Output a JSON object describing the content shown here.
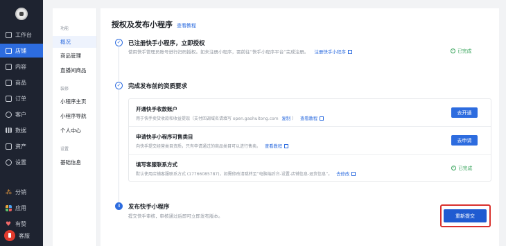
{
  "nav": {
    "items": [
      {
        "label": "工作台",
        "icon": "monitor-icon"
      },
      {
        "label": "店铺",
        "icon": "store-icon"
      },
      {
        "label": "内容",
        "icon": "image-icon"
      },
      {
        "label": "商品",
        "icon": "bag-icon"
      },
      {
        "label": "订单",
        "icon": "document-icon"
      },
      {
        "label": "客户",
        "icon": "user-icon"
      },
      {
        "label": "数据",
        "icon": "bar-chart-icon"
      },
      {
        "label": "资产",
        "icon": "wallet-icon"
      },
      {
        "label": "设置",
        "icon": "gear-icon"
      },
      {
        "label": "分销",
        "icon": "share-icon"
      },
      {
        "label": "应用",
        "icon": "apps-icon"
      },
      {
        "label": "有赞",
        "icon": "youzan-icon"
      }
    ],
    "service_label": "客服",
    "active_index": 1
  },
  "submenu": {
    "groups": [
      {
        "title": "功能",
        "items": [
          "概况",
          "商品管理",
          "直播间商品"
        ]
      },
      {
        "title": "装修",
        "items": [
          "小程序主页",
          "小程序导航",
          "个人中心"
        ]
      },
      {
        "title": "设置",
        "items": [
          "基础信息"
        ]
      }
    ],
    "active_item": "概况"
  },
  "page": {
    "title": "授权及发布小程序",
    "tutorial_link": "查看教程"
  },
  "steps": [
    {
      "title": "已注册快手小程序，立即授权",
      "desc": "使用快手管理员账号进行扫码授权。如未注册小程序，需前往“快手小程序平台”完成注册。",
      "link": "注册快手小程序",
      "status": "已完成"
    },
    {
      "title": "完成发布前的资质要求",
      "tasks": [
        {
          "title": "开通快手收款账户",
          "desc": "用于快手卖货收款和收益提现（支付回调域名请填写 open.gaohuitong.com",
          "copy": "复制",
          "desc_end": "）",
          "link": "查看教程",
          "button": "去开通"
        },
        {
          "title": "申请快手小程序可售类目",
          "desc": "向快手提交经营类目资质，只有申请通过的商品类目可以进行售卖。",
          "link": "查看教程",
          "button": "去申请"
        },
        {
          "title": "填写客服联系方式",
          "desc": "默认使用店铺客服联系方式 (17766085787)，如需修改请跳转至“电脑端后台-设置-店铺信息-退货信息”。",
          "link": "去修改",
          "status": "已完成"
        }
      ]
    },
    {
      "number": "3",
      "title": "发布快手小程序",
      "desc": "提交快手审核，审核通过后即可立即发布版本。",
      "button": "重新提交"
    }
  ]
}
